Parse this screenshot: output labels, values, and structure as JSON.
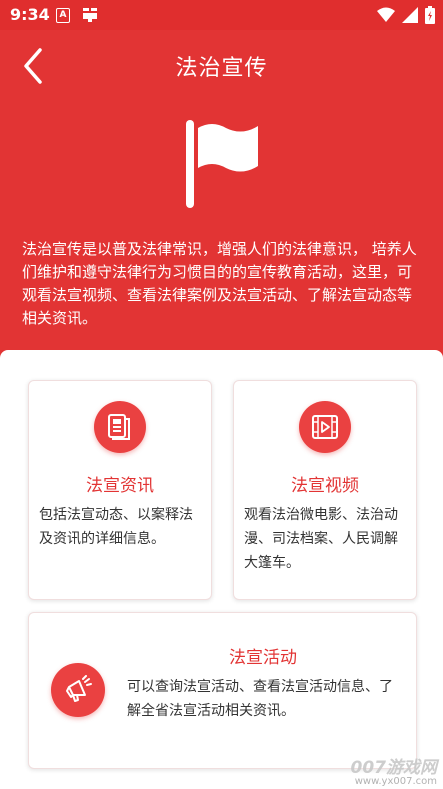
{
  "status_bar": {
    "time": "9:34",
    "a_icon_text": "A"
  },
  "header": {
    "title": "法治宣传"
  },
  "intro": {
    "text": "法治宣传是以普及法律常识，增强人们的法律意识， 培养人们维护和遵守法律行为习惯目的的宣传教育活动，这里，可观看法宣视频、查看法律案例及法宣活动、了解法宣动态等相关资讯。"
  },
  "cards": [
    {
      "title": "法宣资讯",
      "description": "包括法宣动态、以案释法及资讯的详细信息。",
      "icon": "document-icon"
    },
    {
      "title": "法宣视频",
      "description": "观看法治微电影、法治动漫、司法档案、人民调解大篷车。",
      "icon": "video-icon"
    },
    {
      "title": "法宣活动",
      "description": "可以查询法宣活动、查看法宣活动信息、了解全省法宣活动相关资讯。",
      "icon": "megaphone-icon"
    }
  ],
  "watermark": {
    "main": "007游戏网",
    "url": "www.yx007.com"
  },
  "colors": {
    "primary_red": "#e23434",
    "card_title_red": "#e23434",
    "text_dark": "#333333"
  }
}
